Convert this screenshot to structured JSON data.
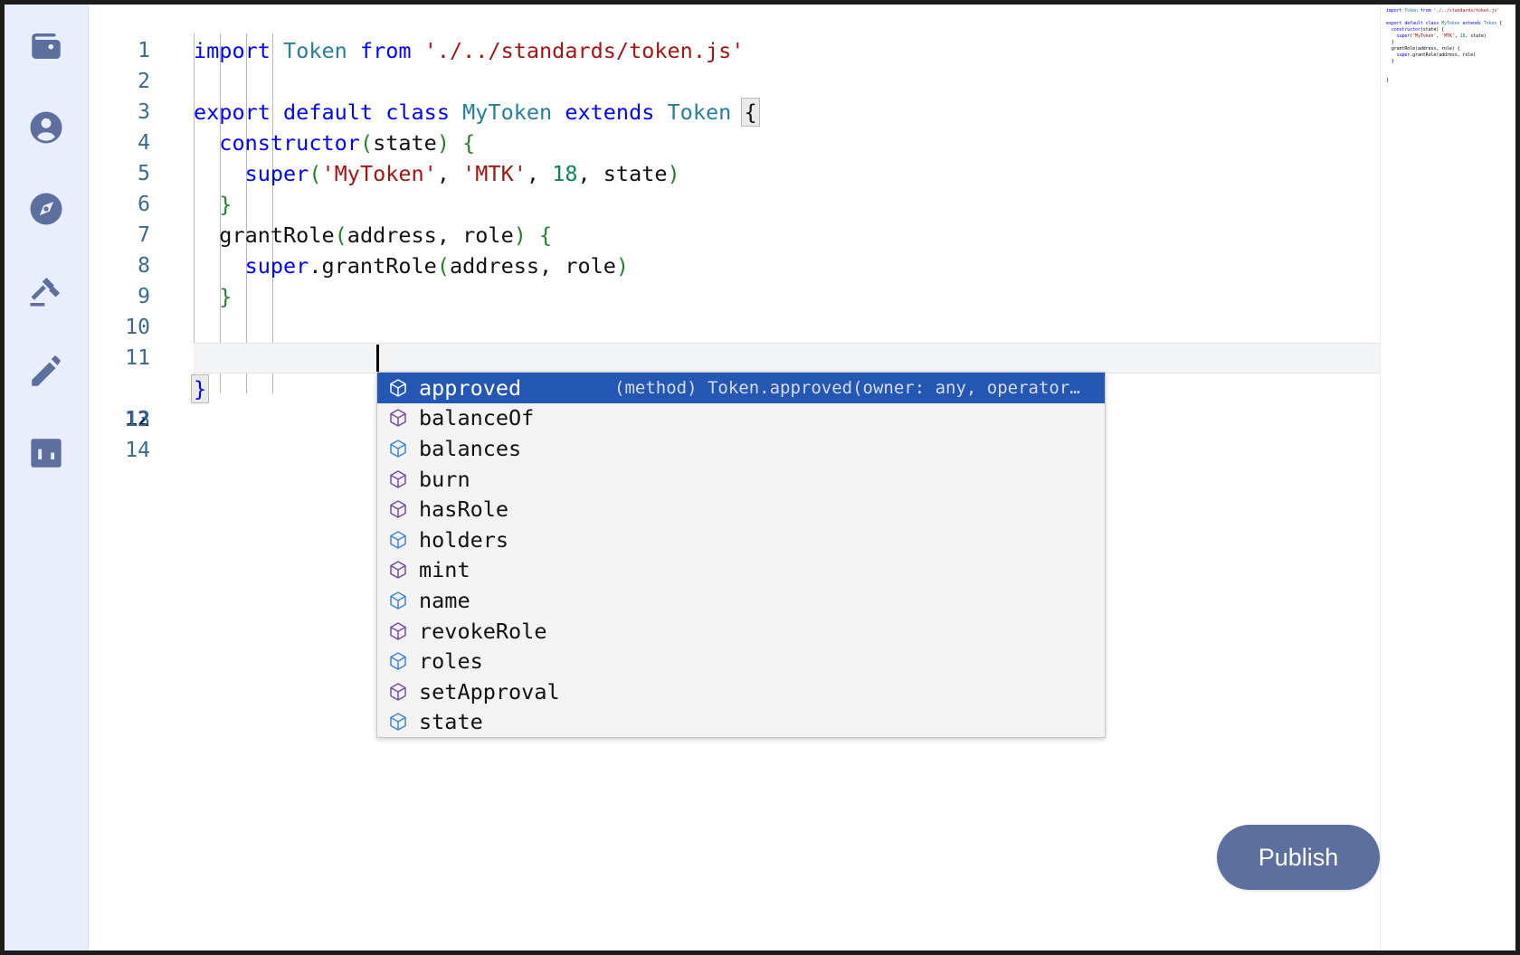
{
  "sidebar": {
    "items": [
      {
        "name": "wallet",
        "label": "Wallet",
        "icon": "wallet-icon"
      },
      {
        "name": "account",
        "label": "Account",
        "icon": "account-circle-icon"
      },
      {
        "name": "explore",
        "label": "Explore",
        "icon": "compass-icon"
      },
      {
        "name": "governance",
        "label": "Governance",
        "icon": "gavel-icon"
      },
      {
        "name": "editor",
        "label": "Editor",
        "icon": "pencil-icon"
      },
      {
        "name": "stats",
        "label": "Stats",
        "icon": "bar-chart-icon"
      }
    ],
    "accent": "#5c6f9e",
    "background": "#e8eefb"
  },
  "editor": {
    "language": "javascript",
    "active_line": 12,
    "cursor": {
      "line": 12,
      "column": 5
    },
    "line_numbers": [
      1,
      2,
      3,
      4,
      5,
      6,
      7,
      8,
      9,
      10,
      11,
      12,
      13,
      14
    ],
    "lines": [
      {
        "n": 1,
        "text": ""
      },
      {
        "n": 2,
        "text": "import Token from './../standards/token.js'"
      },
      {
        "n": 3,
        "text": ""
      },
      {
        "n": 4,
        "text": "export default class MyToken extends Token {"
      },
      {
        "n": 5,
        "text": "  constructor(state) {"
      },
      {
        "n": 6,
        "text": "    super('MyToken', 'MTK', 18, state)"
      },
      {
        "n": 7,
        "text": "  }"
      },
      {
        "n": 8,
        "text": "  grantRole(address, role) {"
      },
      {
        "n": 9,
        "text": "    super.grantRole(address, role)"
      },
      {
        "n": 10,
        "text": "  }"
      },
      {
        "n": 11,
        "text": ""
      },
      {
        "n": 12,
        "text": "  "
      },
      {
        "n": 13,
        "text": "}"
      },
      {
        "n": 14,
        "text": ""
      }
    ],
    "colors": {
      "keyword": "#0000ff",
      "type": "#267f99",
      "string": "#a31515",
      "number": "#098658",
      "plain": "#111111",
      "line_number": "#3a6a8c",
      "active_line_number": "#0b1f5e",
      "active_line_bg": "#f3f4f6"
    }
  },
  "autocomplete": {
    "selected_index": 0,
    "selected_detail": "(method) Token.approved(owner: any, operator…",
    "items": [
      {
        "label": "approved",
        "kind": "method",
        "icon": "cube-purple-icon"
      },
      {
        "label": "balanceOf",
        "kind": "method",
        "icon": "cube-purple-icon"
      },
      {
        "label": "balances",
        "kind": "property",
        "icon": "cube-blue-icon"
      },
      {
        "label": "burn",
        "kind": "method",
        "icon": "cube-purple-icon"
      },
      {
        "label": "hasRole",
        "kind": "method",
        "icon": "cube-purple-icon"
      },
      {
        "label": "holders",
        "kind": "property",
        "icon": "cube-blue-icon"
      },
      {
        "label": "mint",
        "kind": "method",
        "icon": "cube-purple-icon"
      },
      {
        "label": "name",
        "kind": "property",
        "icon": "cube-blue-icon"
      },
      {
        "label": "revokeRole",
        "kind": "method",
        "icon": "cube-purple-icon"
      },
      {
        "label": "roles",
        "kind": "property",
        "icon": "cube-blue-icon"
      },
      {
        "label": "setApproval",
        "kind": "method",
        "icon": "cube-purple-icon"
      },
      {
        "label": "state",
        "kind": "property",
        "icon": "cube-blue-icon"
      }
    ],
    "selection_color": "#2456b3",
    "background": "#f3f3f3"
  },
  "minimap": {
    "lines": [
      "import Token from './../standards/token.js'",
      "",
      "export default class MyToken extends Token {",
      "  constructor(state) {",
      "    super('MyToken', 'MTK', 18, state)",
      "  }",
      "  grantRole(address, role) {",
      "    super.grantRole(address, role)",
      "  }",
      "",
      "",
      "}"
    ]
  },
  "actions": {
    "publish_label": "Publish",
    "publish_color": "#5c6f9e"
  }
}
